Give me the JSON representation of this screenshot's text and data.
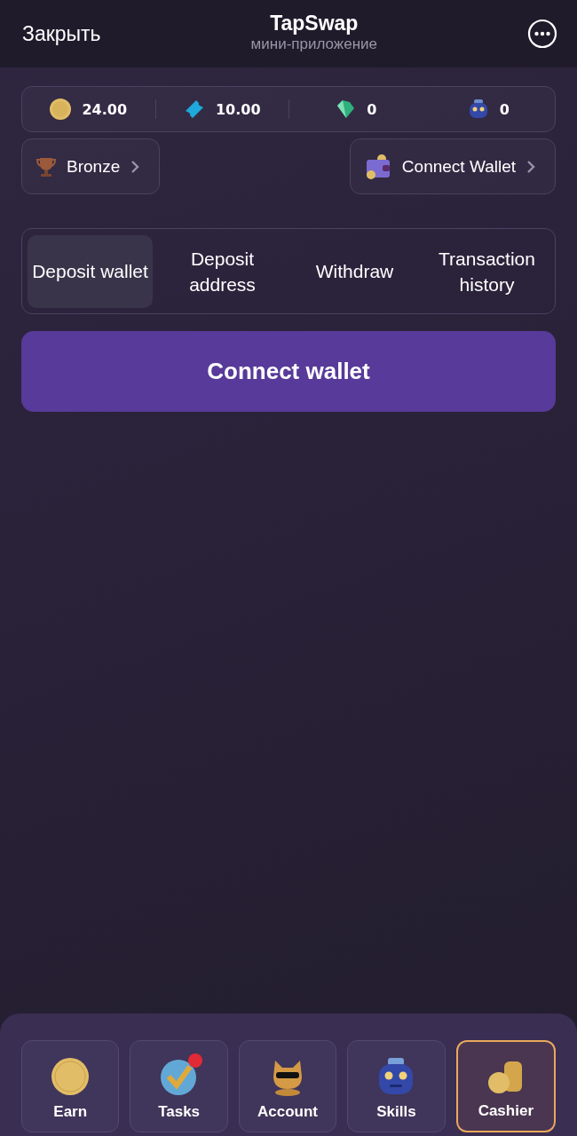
{
  "header": {
    "close": "Закрыть",
    "title": "TapSwap",
    "subtitle": "мини-приложение"
  },
  "stats": [
    {
      "kind": "coin",
      "value": "24.00"
    },
    {
      "kind": "ticket",
      "value": "10.00"
    },
    {
      "kind": "gem",
      "value": "0"
    },
    {
      "kind": "robot",
      "value": "0"
    }
  ],
  "league": {
    "label": "Bronze"
  },
  "wallet_link": {
    "label": "Connect Wallet"
  },
  "tabs": [
    {
      "label": "Deposit wallet",
      "selected": true
    },
    {
      "label": "Deposit address",
      "selected": false
    },
    {
      "label": "Withdraw",
      "selected": false
    },
    {
      "label": "Transaction history",
      "selected": false
    }
  ],
  "connect_button": "Connect wallet",
  "nav": [
    {
      "kind": "coin",
      "label": "Earn",
      "selected": false,
      "badge": false
    },
    {
      "kind": "check",
      "label": "Tasks",
      "selected": false,
      "badge": true
    },
    {
      "kind": "cat",
      "label": "Account",
      "selected": false,
      "badge": false
    },
    {
      "kind": "robot",
      "label": "Skills",
      "selected": false,
      "badge": false
    },
    {
      "kind": "coins",
      "label": "Cashier",
      "selected": true,
      "badge": false
    }
  ]
}
